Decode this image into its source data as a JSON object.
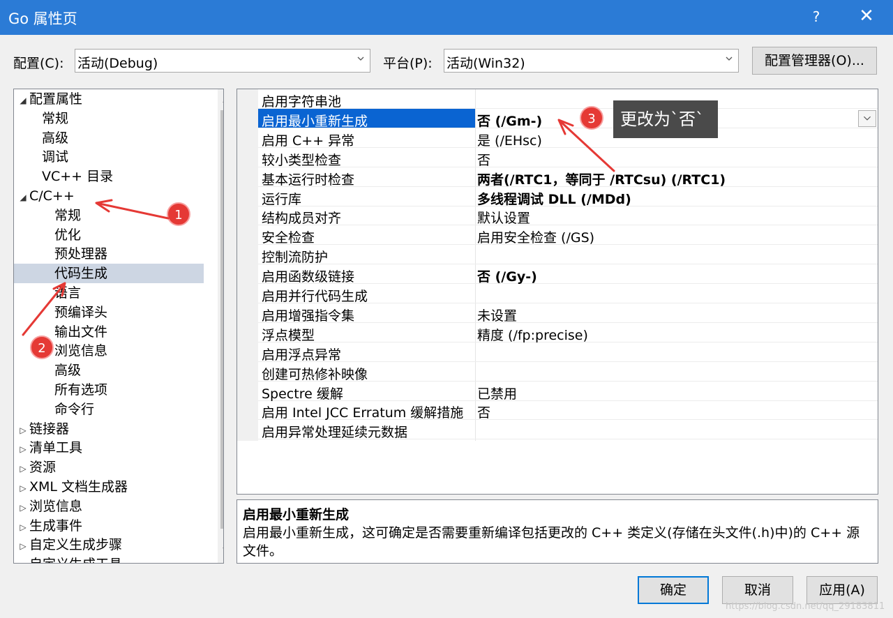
{
  "window": {
    "title": "Go 属性页",
    "help_label": "?",
    "close_label": "✕"
  },
  "config_bar": {
    "config_label": "配置(C):",
    "config_value": "活动(Debug)",
    "platform_label": "平台(P):",
    "platform_value": "活动(Win32)",
    "manager_button": "配置管理器(O)..."
  },
  "tree": {
    "items": [
      {
        "label": "配置属性",
        "toggle": "◢"
      },
      {
        "label": "常规",
        "toggle": ""
      },
      {
        "label": "高级",
        "toggle": ""
      },
      {
        "label": "调试",
        "toggle": ""
      },
      {
        "label": "VC++ 目录",
        "toggle": ""
      },
      {
        "label": "C/C++",
        "toggle": "◢"
      },
      {
        "label": "常规",
        "toggle": ""
      },
      {
        "label": "优化",
        "toggle": ""
      },
      {
        "label": "预处理器",
        "toggle": ""
      },
      {
        "label": "代码生成",
        "toggle": ""
      },
      {
        "label": "语言",
        "toggle": ""
      },
      {
        "label": "预编译头",
        "toggle": ""
      },
      {
        "label": "输出文件",
        "toggle": ""
      },
      {
        "label": "浏览信息",
        "toggle": ""
      },
      {
        "label": "高级",
        "toggle": ""
      },
      {
        "label": "所有选项",
        "toggle": ""
      },
      {
        "label": "命令行",
        "toggle": ""
      },
      {
        "label": "链接器",
        "toggle": "▷"
      },
      {
        "label": "清单工具",
        "toggle": "▷"
      },
      {
        "label": "资源",
        "toggle": "▷"
      },
      {
        "label": "XML 文档生成器",
        "toggle": "▷"
      },
      {
        "label": "浏览信息",
        "toggle": "▷"
      },
      {
        "label": "生成事件",
        "toggle": "▷"
      },
      {
        "label": "自定义生成步骤",
        "toggle": "▷"
      },
      {
        "label": "自定义生成工具",
        "toggle": "▷"
      }
    ],
    "selected_index": 9,
    "scroll_up": "︿",
    "scroll_down": "﹀"
  },
  "properties": {
    "rows": [
      {
        "name": "启用字符串池",
        "value": "",
        "bold": false
      },
      {
        "name": "启用最小重新生成",
        "value": "否 (/Gm-)",
        "bold": true
      },
      {
        "name": "启用 C++ 异常",
        "value": "是 (/EHsc)",
        "bold": false
      },
      {
        "name": "较小类型检查",
        "value": "否",
        "bold": false
      },
      {
        "name": "基本运行时检查",
        "value": "两者(/RTC1，等同于 /RTCsu) (/RTC1)",
        "bold": true
      },
      {
        "name": "运行库",
        "value": "多线程调试 DLL (/MDd)",
        "bold": true
      },
      {
        "name": "结构成员对齐",
        "value": "默认设置",
        "bold": false
      },
      {
        "name": "安全检查",
        "value": "启用安全检查 (/GS)",
        "bold": false
      },
      {
        "name": "控制流防护",
        "value": "",
        "bold": false
      },
      {
        "name": "启用函数级链接",
        "value": "否 (/Gy-)",
        "bold": true
      },
      {
        "name": "启用并行代码生成",
        "value": "",
        "bold": false
      },
      {
        "name": "启用增强指令集",
        "value": "未设置",
        "bold": false
      },
      {
        "name": "浮点模型",
        "value": "精度 (/fp:precise)",
        "bold": false
      },
      {
        "name": "启用浮点异常",
        "value": "",
        "bold": false
      },
      {
        "name": "创建可热修补映像",
        "value": "",
        "bold": false
      },
      {
        "name": "Spectre 缓解",
        "value": "已禁用",
        "bold": false
      },
      {
        "name": "启用 Intel JCC Erratum 缓解措施",
        "value": "否",
        "bold": false
      },
      {
        "name": "启用异常处理延续元数据",
        "value": "",
        "bold": false
      }
    ],
    "selected_index": 1
  },
  "description": {
    "title": "启用最小重新生成",
    "body": "启用最小重新生成，这可确定是否需要重新编译包括更改的 C++ 类定义(存储在头文件(.h)中)的 C++ 源文件。"
  },
  "buttons": {
    "ok": "确定",
    "cancel": "取消",
    "apply": "应用(A)"
  },
  "annotations": {
    "callout_text": "更改为`否`",
    "badge1": "1",
    "badge2": "2",
    "badge3": "3",
    "arrow_color": "#e53935"
  },
  "watermark": "https://blog.csdn.net/qq_29183811"
}
